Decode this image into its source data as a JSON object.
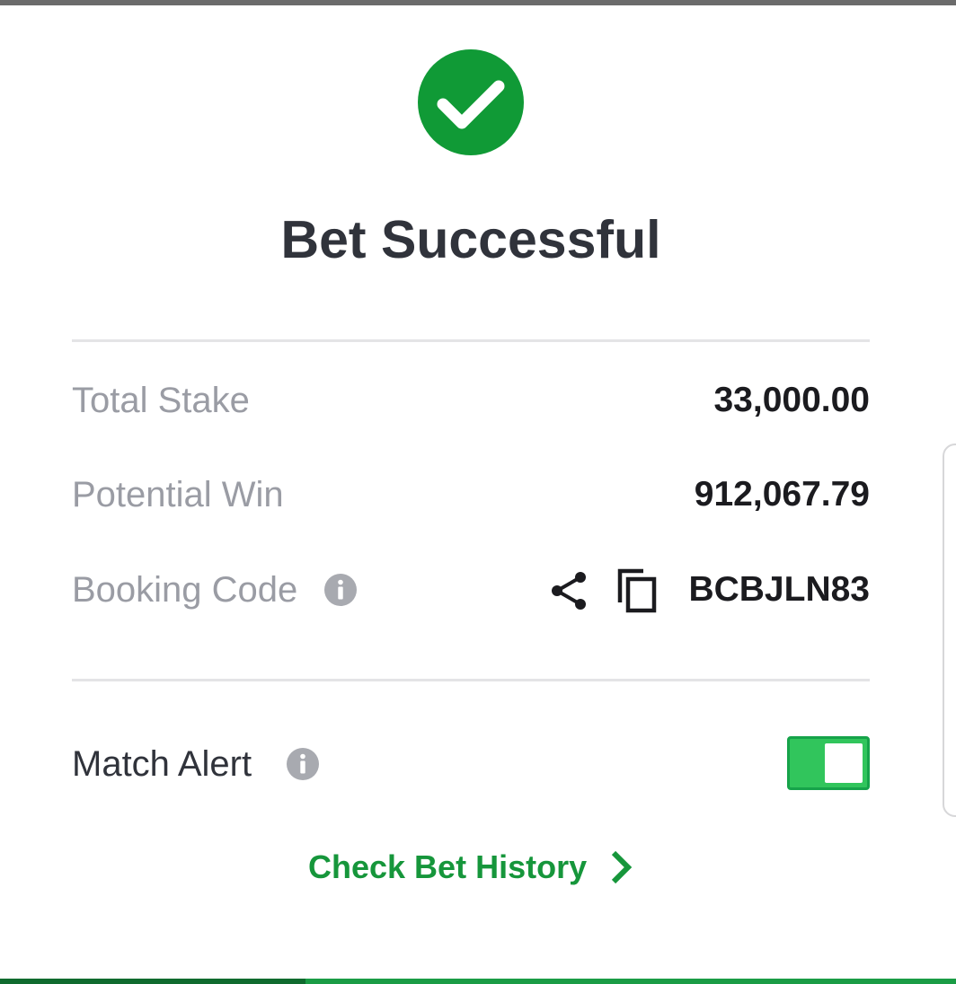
{
  "dialog": {
    "title": "Bet Successful",
    "status_icon": "check-circle-icon",
    "accent_color": "#16963b"
  },
  "summary": {
    "total_stake_label": "Total Stake",
    "total_stake_value": "33,000.00",
    "potential_win_label": "Potential Win",
    "potential_win_value": "912,067.79",
    "booking_code_label": "Booking Code",
    "booking_code_value": "BCBJLN83"
  },
  "match_alert": {
    "label": "Match Alert",
    "enabled": true
  },
  "footer": {
    "history_link": "Check Bet History"
  },
  "icons": [
    "check-circle-icon",
    "info-icon",
    "share-icon",
    "copy-icon",
    "chevron-right-icon"
  ]
}
